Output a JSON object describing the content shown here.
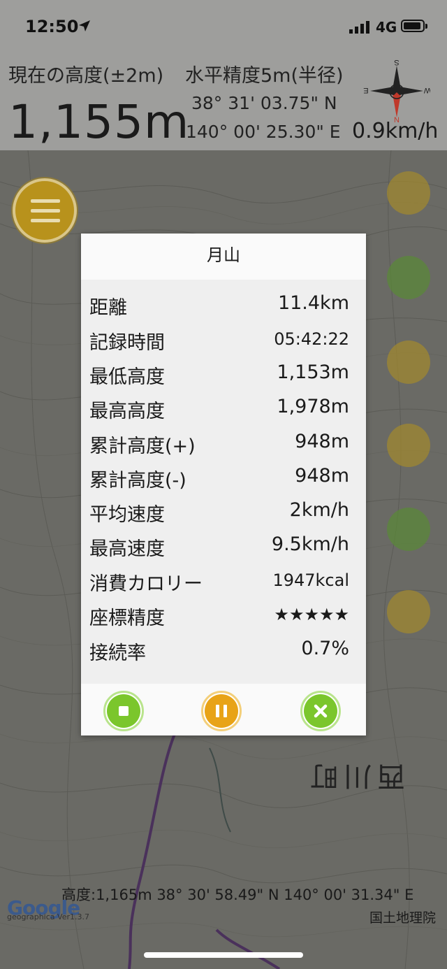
{
  "status": {
    "time": "12:50",
    "network": "4G"
  },
  "header": {
    "altitude_label": "現在の高度(±2m)",
    "altitude_value": "1,155m",
    "accuracy_label": "水平精度5m(半径)",
    "latitude": "38° 31' 03.75\" N",
    "longitude": "140° 00' 25.30\" E",
    "speed": "0.9km/h",
    "compass": {
      "north": "N",
      "south": "S",
      "east": "E",
      "west": "W"
    }
  },
  "dialog": {
    "title": "月山",
    "rows": [
      {
        "label": "距離",
        "value": "11.4km"
      },
      {
        "label": "記録時間",
        "value": "05:42:22"
      },
      {
        "label": "最低高度",
        "value": "1,153m"
      },
      {
        "label": "最高高度",
        "value": "1,978m"
      },
      {
        "label": "累計高度(+)",
        "value": "948m"
      },
      {
        "label": "累計高度(-)",
        "value": "948m"
      },
      {
        "label": "平均速度",
        "value": "2km/h"
      },
      {
        "label": "最高速度",
        "value": "9.5km/h"
      },
      {
        "label": "消費カロリー",
        "value": "1947kcal"
      },
      {
        "label": "座標精度",
        "value": "★★★★★"
      },
      {
        "label": "接続率",
        "value": "0.7%"
      }
    ],
    "buttons": {
      "stop": "stop-icon",
      "pause": "pause-icon",
      "close": "close-icon"
    }
  },
  "map": {
    "town_label": "西川町",
    "cursor_info": "高度:1,165m  38° 30' 58.49\" N 140° 00' 31.34\" E",
    "google": "Google",
    "version": "geographica Ver1.3.7",
    "attribution": "国土地理院"
  },
  "colors": {
    "green": "#7bc62c",
    "orange": "#e8a317",
    "menu": "#b8921c"
  }
}
